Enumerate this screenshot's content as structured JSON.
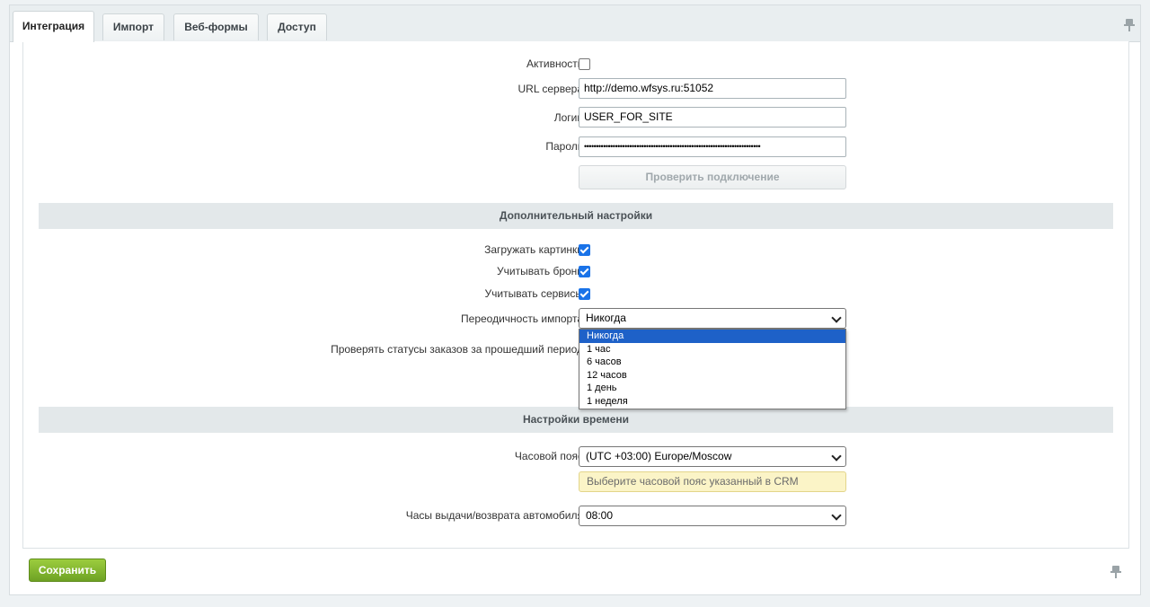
{
  "tabs": [
    {
      "label": "Интеграция",
      "active": true
    },
    {
      "label": "Импорт",
      "active": false
    },
    {
      "label": "Веб-формы",
      "active": false
    },
    {
      "label": "Доступ",
      "active": false
    }
  ],
  "connection": {
    "active_label": "Активность",
    "active_checked": false,
    "url_label": "URL сервера",
    "url_value": "http://demo.wfsys.ru:51052",
    "login_label": "Логин",
    "login_value": "USER_FOR_SITE",
    "password_label": "Пароль",
    "password_value": "••••••••••••••••••••••••••••••••••••••••••••••••••••••••••••••••••••••••••",
    "check_button": "Проверить подключение"
  },
  "additional": {
    "header": "Дополнительный настройки",
    "load_images_label": "Загружать картинки",
    "load_images_checked": true,
    "bookings_label": "Учитывать брони",
    "bookings_checked": true,
    "services_label": "Учитывать сервисы",
    "services_checked": true,
    "import_period_label": "Переодичность импорта",
    "import_period_value": "Никогда",
    "import_period_options": [
      "Никогда",
      "1 час",
      "6 часов",
      "12 часов",
      "1 день",
      "1 неделя"
    ],
    "check_statuses_label": "Проверять статусы заказов за прошедший период"
  },
  "time": {
    "header": "Настройки времени",
    "timezone_label": "Часовой пояс",
    "timezone_value": "(UTC +03:00) Europe/Moscow",
    "timezone_hint": "Выберите часовой пояс указанный в CRM",
    "hours_label": "Часы выдачи/возврата автомобиля",
    "hours_value": "08:00"
  },
  "footer": {
    "save_label": "Сохранить"
  },
  "colors": {
    "checkbox_on": "#1a73e8",
    "save_button": "#7cb32a",
    "selected_option": "#1e61c8",
    "hint_bg": "#fbf4c7"
  }
}
